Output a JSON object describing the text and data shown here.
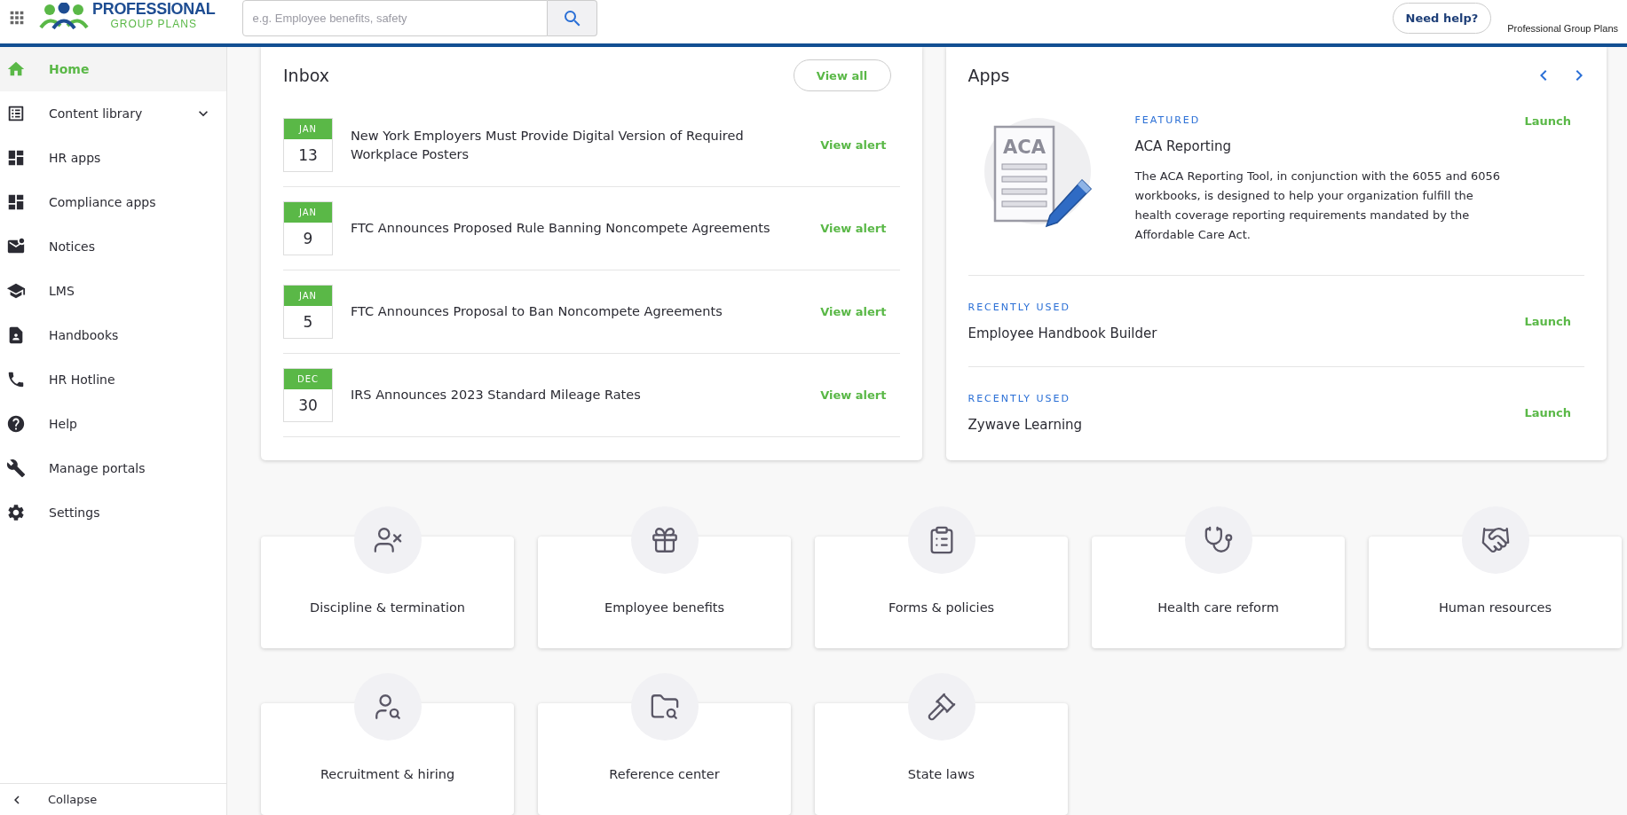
{
  "header": {
    "logo": {
      "top": "PROFESSIONAL",
      "bottom": "GROUP PLANS"
    },
    "search": {
      "placeholder": "e.g. Employee benefits, safety"
    },
    "help_button": "Need help?",
    "account": "Professional Group Plans"
  },
  "sidebar": {
    "items": [
      {
        "label": "Home",
        "selected": true,
        "expandable": false
      },
      {
        "label": "Content library",
        "selected": false,
        "expandable": true
      },
      {
        "label": "HR apps",
        "selected": false,
        "expandable": false
      },
      {
        "label": "Compliance apps",
        "selected": false,
        "expandable": false
      },
      {
        "label": "Notices",
        "selected": false,
        "expandable": false
      },
      {
        "label": "LMS",
        "selected": false,
        "expandable": false
      },
      {
        "label": "Handbooks",
        "selected": false,
        "expandable": false
      },
      {
        "label": "HR Hotline",
        "selected": false,
        "expandable": false
      },
      {
        "label": "Help",
        "selected": false,
        "expandable": false
      },
      {
        "label": "Manage portals",
        "selected": false,
        "expandable": false
      },
      {
        "label": "Settings",
        "selected": false,
        "expandable": false
      }
    ],
    "collapse": "Collapse"
  },
  "inbox": {
    "title": "Inbox",
    "view_all": "View all",
    "alerts": [
      {
        "month": "JAN",
        "day": "13",
        "title": "New York Employers Must Provide Digital Version of Required Workplace Posters",
        "action": "View alert"
      },
      {
        "month": "JAN",
        "day": "9",
        "title": "FTC Announces Proposed Rule Banning Noncompete Agreements",
        "action": "View alert"
      },
      {
        "month": "JAN",
        "day": "5",
        "title": "FTC Announces Proposal to Ban Noncompete Agreements",
        "action": "View alert"
      },
      {
        "month": "DEC",
        "day": "30",
        "title": "IRS Announces 2023 Standard Mileage Rates",
        "action": "View alert"
      }
    ]
  },
  "apps": {
    "title": "Apps",
    "featured": {
      "illustration_label": "ACA",
      "tag": "FEATURED",
      "name": "ACA Reporting",
      "description": "The ACA Reporting Tool, in conjunction with the 6055 and 6056 workbooks, is designed to help your organization fulfill the health coverage reporting requirements mandated by the Affordable Care Act.",
      "action": "Launch"
    },
    "recent": [
      {
        "tag": "RECENTLY USED",
        "name": "Employee Handbook Builder",
        "action": "Launch"
      },
      {
        "tag": "RECENTLY USED",
        "name": "Zywave Learning",
        "action": "Launch"
      }
    ]
  },
  "topics": [
    {
      "label": "Discipline & termination"
    },
    {
      "label": "Employee benefits"
    },
    {
      "label": "Forms & policies"
    },
    {
      "label": "Health care reform"
    },
    {
      "label": "Human resources"
    },
    {
      "label": "Recruitment & hiring"
    },
    {
      "label": "Reference center"
    },
    {
      "label": "State laws"
    }
  ]
}
